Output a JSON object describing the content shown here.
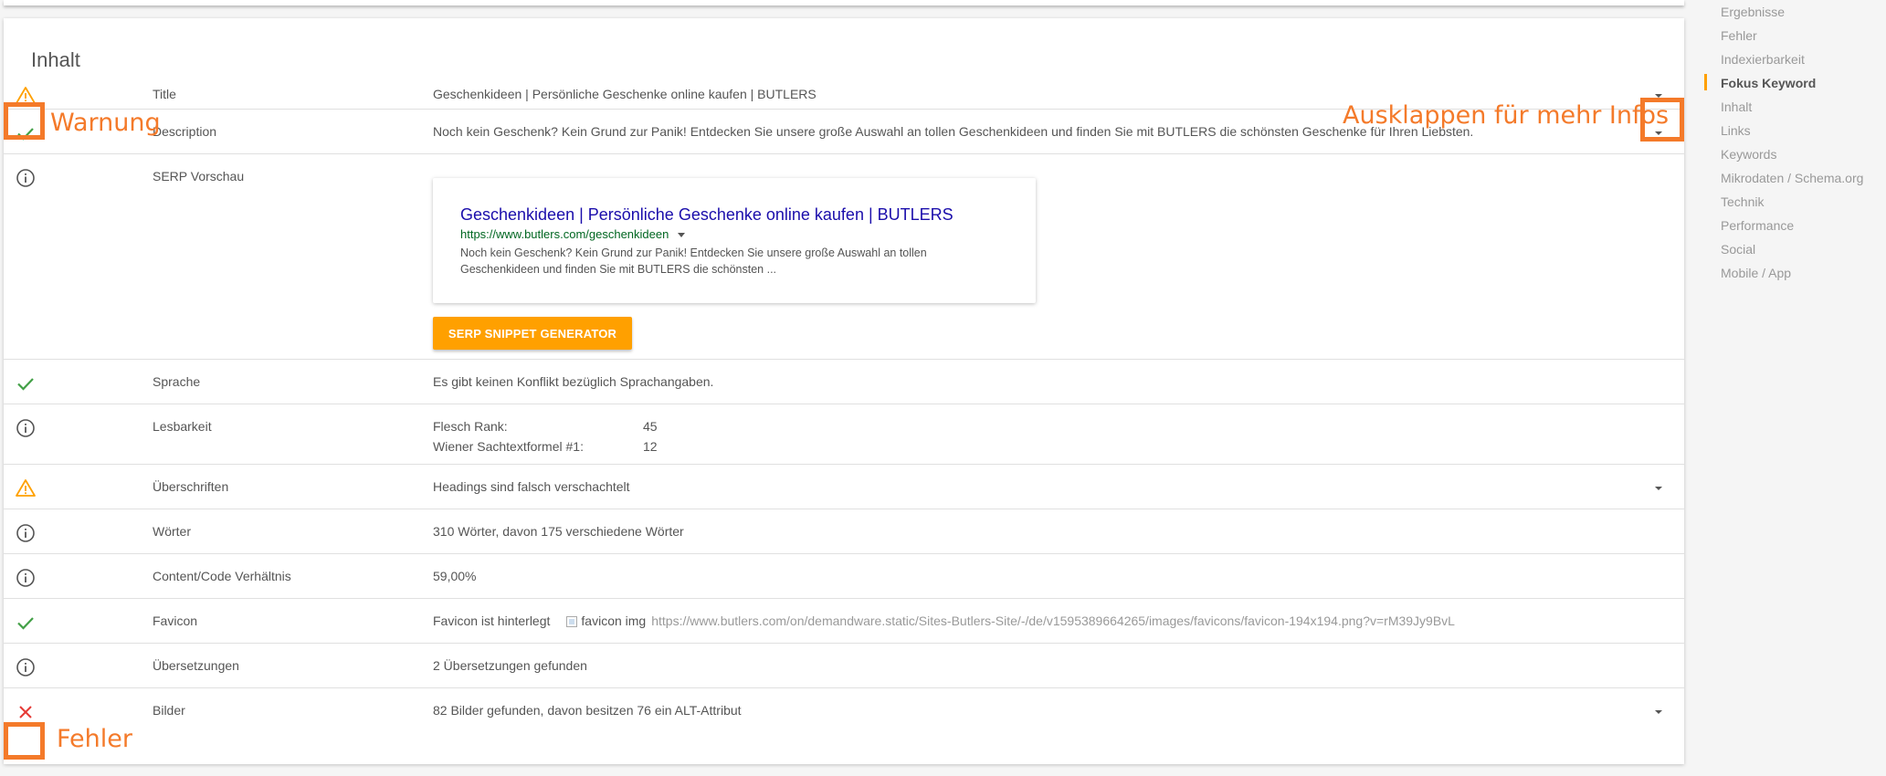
{
  "section_title": "Inhalt",
  "rows": [
    {
      "status": "warning",
      "label": "Title",
      "value": "Geschenkideen | Persönliche Geschenke online kaufen | BUTLERS",
      "expandable": true
    },
    {
      "status": "ok",
      "label": "Description",
      "value": "Noch kein Geschenk? Kein Grund zur Panik! Entdecken Sie unsere große Auswahl an tollen Geschenkideen und finden Sie mit BUTLERS die schönsten Geschenke für Ihren Liebsten.",
      "expandable": true
    },
    {
      "status": "info",
      "label": "SERP Vorschau"
    },
    {
      "status": "ok",
      "label": "Sprache",
      "value": "Es gibt keinen Konflikt bezüglich Sprachangaben."
    },
    {
      "status": "info",
      "label": "Lesbarkeit"
    },
    {
      "status": "warning",
      "label": "Überschriften",
      "value": "Headings sind falsch verschachtelt",
      "expandable": true
    },
    {
      "status": "info",
      "label": "Wörter",
      "value": "310 Wörter, davon 175 verschiedene Wörter"
    },
    {
      "status": "info",
      "label": "Content/Code Verhältnis",
      "value": "59,00%"
    },
    {
      "status": "ok",
      "label": "Favicon"
    },
    {
      "status": "info",
      "label": "Übersetzungen",
      "value": "2 Übersetzungen gefunden"
    },
    {
      "status": "error",
      "label": "Bilder",
      "value": "82 Bilder gefunden, davon besitzen 76 ein ALT-Attribut",
      "expandable": true
    }
  ],
  "serp": {
    "title": "Geschenkideen | Persönliche Geschenke online kaufen | BUTLERS",
    "url": "https://www.butlers.com/geschenkideen",
    "description": "Noch kein Geschenk? Kein Grund zur Panik! Entdecken Sie unsere große Auswahl an tollen Geschenkideen und finden Sie mit BUTLERS die schönsten ...",
    "button_label": "SERP SNIPPET GENERATOR"
  },
  "readability": [
    {
      "key": "Flesch Rank:",
      "value": "45"
    },
    {
      "key": "Wiener Sachtextformel #1:",
      "value": "12"
    }
  ],
  "favicon": {
    "status_text": "Favicon ist hinterlegt",
    "img_alt": "favicon img",
    "url": "https://www.butlers.com/on/demandware.static/Sites-Butlers-Site/-/de/v1595389664265/images/favicons/favicon-194x194.png?v=rM39Jy9BvL"
  },
  "annotations": {
    "warning": "Warnung",
    "expand": "Ausklappen für mehr Infos",
    "error": "Fehler"
  },
  "sidebar": {
    "items": [
      "Ergebnisse",
      "Fehler",
      "Indexierbarkeit",
      "Fokus Keyword",
      "Inhalt",
      "Links",
      "Keywords",
      "Mikrodaten / Schema.org",
      "Technik",
      "Performance",
      "Social",
      "Mobile / App"
    ],
    "active": "Fokus Keyword"
  },
  "colors": {
    "warning": "#ffa000",
    "ok": "#43a047",
    "info": "#555555",
    "error": "#e53935",
    "annotation": "#f47a2a",
    "serp_title": "#1a0dab",
    "serp_url": "#006621",
    "button": "#ffa000"
  },
  "icons": {
    "warning": "warning-triangle-icon",
    "ok": "checkmark-icon",
    "info": "info-circle-icon",
    "error": "error-x-icon",
    "expand": "chevron-down-icon"
  }
}
